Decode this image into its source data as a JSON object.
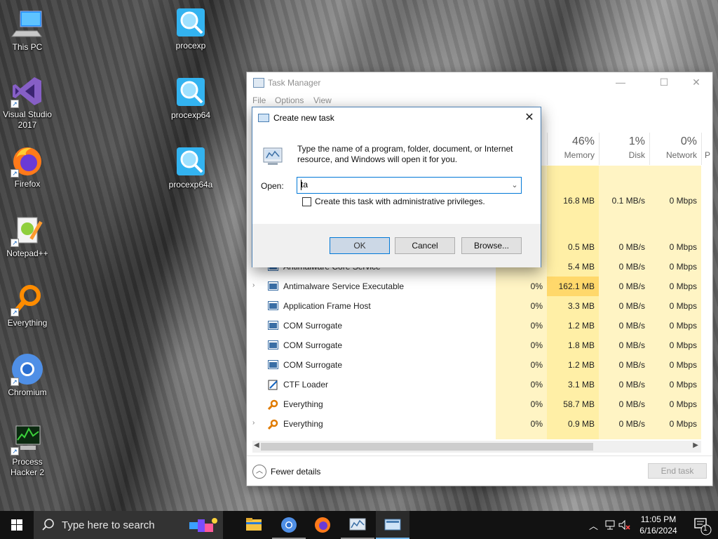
{
  "desktop": {
    "icons": [
      {
        "label": "This PC",
        "icon": "computer-icon"
      },
      {
        "label": "Visual Studio 2017",
        "icon": "visual-studio-icon"
      },
      {
        "label": "Firefox",
        "icon": "firefox-icon"
      },
      {
        "label": "Notepad++",
        "icon": "notepadpp-icon"
      },
      {
        "label": "Everything",
        "icon": "everything-icon"
      },
      {
        "label": "Chromium",
        "icon": "chromium-icon"
      },
      {
        "label": "Process Hacker 2",
        "icon": "process-hacker-icon"
      },
      {
        "label": "procexp",
        "icon": "procexp-icon"
      },
      {
        "label": "procexp64",
        "icon": "procexp-icon"
      },
      {
        "label": "procexp64a",
        "icon": "procexp-icon"
      }
    ]
  },
  "task_manager": {
    "title": "Task Manager",
    "menu": [
      "File",
      "Options",
      "View"
    ],
    "columns": [
      {
        "pct": "46%",
        "label": "Memory"
      },
      {
        "pct": "1%",
        "label": "Disk"
      },
      {
        "pct": "0%",
        "label": "Network"
      },
      {
        "pct": "",
        "label": "P"
      }
    ],
    "partial_rows": [
      {
        "mem": "16.8 MB",
        "disk": "0.1 MB/s",
        "net": "0 Mbps"
      },
      {
        "mem": "0.5 MB",
        "disk": "0 MB/s",
        "net": "0 Mbps"
      }
    ],
    "rows": [
      {
        "name": "Antimalware Core Service",
        "cpu": "",
        "mem": "5.4 MB",
        "disk": "0 MB/s",
        "net": "0 Mbps",
        "expand": false,
        "icon": "service-icon"
      },
      {
        "name": "Antimalware Service Executable",
        "cpu": "0%",
        "mem": "162.1 MB",
        "disk": "0 MB/s",
        "net": "0 Mbps",
        "expand": true,
        "icon": "service-icon"
      },
      {
        "name": "Application Frame Host",
        "cpu": "0%",
        "mem": "3.3 MB",
        "disk": "0 MB/s",
        "net": "0 Mbps",
        "expand": false,
        "icon": "service-icon"
      },
      {
        "name": "COM Surrogate",
        "cpu": "0%",
        "mem": "1.2 MB",
        "disk": "0 MB/s",
        "net": "0 Mbps",
        "expand": false,
        "icon": "service-icon"
      },
      {
        "name": "COM Surrogate",
        "cpu": "0%",
        "mem": "1.8 MB",
        "disk": "0 MB/s",
        "net": "0 Mbps",
        "expand": false,
        "icon": "service-icon"
      },
      {
        "name": "COM Surrogate",
        "cpu": "0%",
        "mem": "1.2 MB",
        "disk": "0 MB/s",
        "net": "0 Mbps",
        "expand": false,
        "icon": "service-icon"
      },
      {
        "name": "CTF Loader",
        "cpu": "0%",
        "mem": "3.1 MB",
        "disk": "0 MB/s",
        "net": "0 Mbps",
        "expand": false,
        "icon": "ctf-icon"
      },
      {
        "name": "Everything",
        "cpu": "0%",
        "mem": "58.7 MB",
        "disk": "0 MB/s",
        "net": "0 Mbps",
        "expand": false,
        "icon": "everything-icon"
      },
      {
        "name": "Everything",
        "cpu": "0%",
        "mem": "0.9 MB",
        "disk": "0 MB/s",
        "net": "0 Mbps",
        "expand": true,
        "icon": "everything-icon"
      }
    ],
    "fewer_details": "Fewer details",
    "end_task": "End task"
  },
  "run_dialog": {
    "title": "Create new task",
    "description": "Type the name of a program, folder, document, or Internet resource, and Windows will open it for you.",
    "open_label": "Open:",
    "open_value": "ta",
    "admin_checkbox_label": "Create this task with administrative privileges.",
    "admin_checked": false,
    "ok": "OK",
    "cancel": "Cancel",
    "browse": "Browse..."
  },
  "taskbar": {
    "search_placeholder": "Type here to search",
    "apps": [
      "file-explorer-icon",
      "chromium-icon",
      "firefox-icon",
      "task-manager-icon",
      "create-new-task-icon"
    ],
    "time": "11:05 PM",
    "date": "6/16/2024",
    "notification_count": "1"
  },
  "colors": {
    "accent": "#0078d7",
    "heat_light": "#fff4c4",
    "heat_mid": "#ffefa6"
  }
}
